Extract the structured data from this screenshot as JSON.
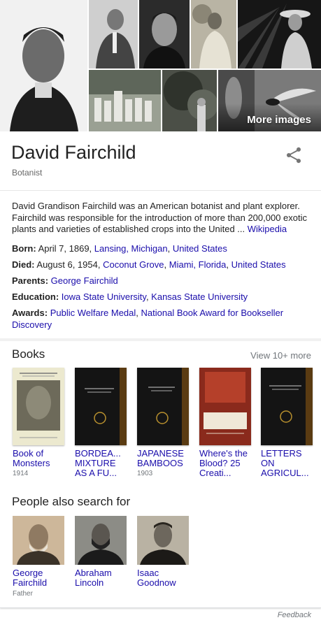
{
  "images": {
    "more_label": "More images",
    "items": [
      {
        "name": "portrait-main"
      },
      {
        "name": "portrait-elderly-suit"
      },
      {
        "name": "portrait-young"
      },
      {
        "name": "photo-outdoor-hat"
      },
      {
        "name": "photo-palm-hat"
      },
      {
        "name": "photo-group-children"
      },
      {
        "name": "photo-tree"
      },
      {
        "name": "photo-man-plants"
      },
      {
        "name": "photo-insect"
      }
    ]
  },
  "entity": {
    "title": "David Fairchild",
    "subtitle": "Botanist"
  },
  "description": {
    "text": "David Grandison Fairchild was an American botanist and plant explorer. Fairchild was responsible for the introduction of more than 200,000 exotic plants and varieties of established crops into the United ... ",
    "source_link": "Wikipedia"
  },
  "facts": {
    "born": {
      "label": "Born:",
      "text": " April 7, 1869, ",
      "links": [
        "Lansing, Michigan",
        "United States"
      ]
    },
    "died": {
      "label": "Died:",
      "text": " August 6, 1954, ",
      "links": [
        "Coconut Grove",
        "Miami, Florida",
        "United States"
      ]
    },
    "parents": {
      "label": "Parents:",
      "links": [
        "George Fairchild"
      ]
    },
    "education": {
      "label": "Education:",
      "links": [
        "Iowa State University",
        "Kansas State University"
      ]
    },
    "awards": {
      "label": "Awards:",
      "links": [
        "Public Welfare Medal",
        "National Book Award for Bookseller Discovery"
      ]
    }
  },
  "books": {
    "title": "Books",
    "view_more": "View 10+ more",
    "items": [
      {
        "title": "Book of Monsters",
        "year": "1914",
        "cover_color": "#e9e6c9"
      },
      {
        "title": "BORDEA... MIXTURE AS A FU...",
        "year": "",
        "cover_color": "#141414"
      },
      {
        "title": "JAPANESE BAMBOOS",
        "year": "1903",
        "cover_color": "#141414"
      },
      {
        "title": "Where's the Blood? 25 Creati...",
        "year": "",
        "cover_color": "#8a2a1c"
      },
      {
        "title": "LETTERS ON AGRICUL...",
        "year": "",
        "cover_color": "#141414"
      }
    ]
  },
  "people": {
    "title": "People also search for",
    "items": [
      {
        "name": "George Fairchild",
        "relation": "Father"
      },
      {
        "name": "Abraham Lincoln",
        "relation": ""
      },
      {
        "name": "Isaac Goodnow",
        "relation": ""
      }
    ]
  },
  "feedback": "Feedback",
  "colors": {
    "link": "#1a0dab",
    "text": "#222222",
    "muted": "#70757a"
  }
}
